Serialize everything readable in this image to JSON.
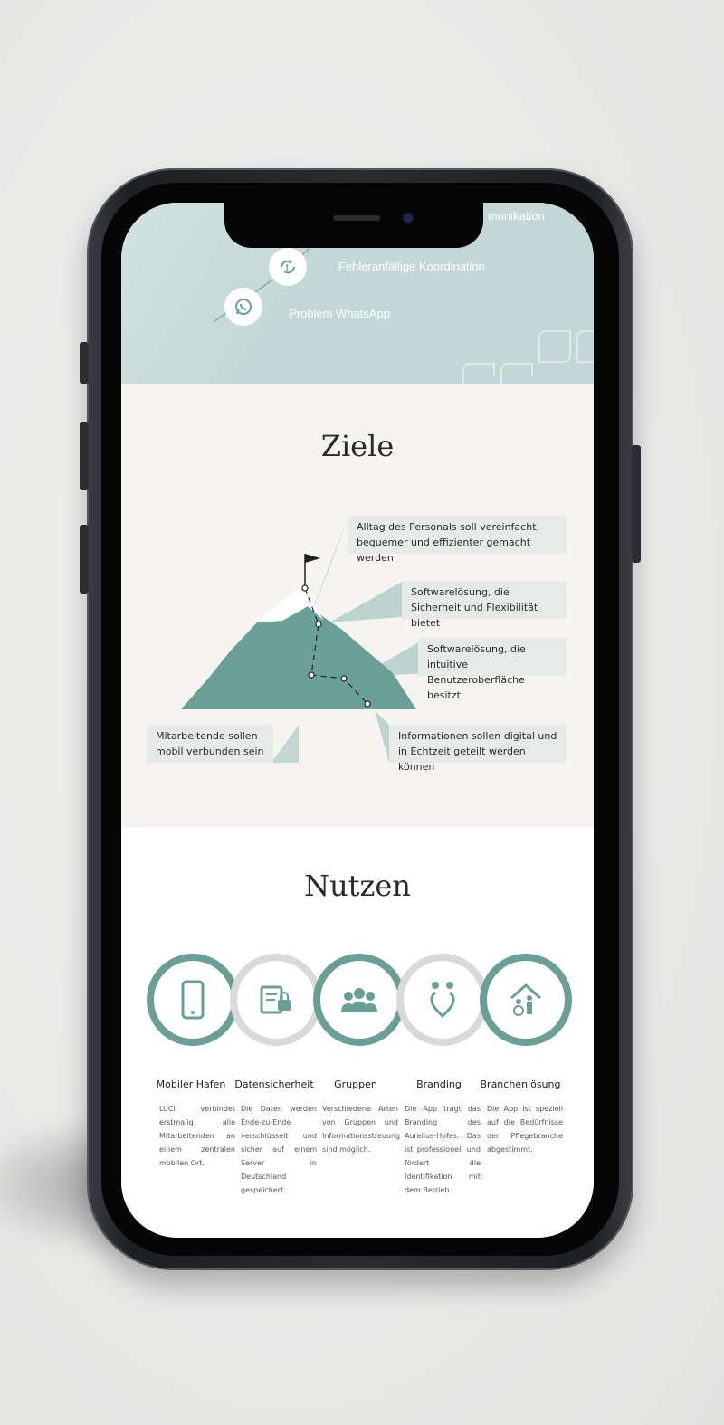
{
  "hero": {
    "items": [
      {
        "label": "munikation",
        "icon": "chat-icon"
      },
      {
        "label": "Fehleranfällige Koordination",
        "icon": "sync-alert-icon"
      },
      {
        "label": "Problem WhatsApp",
        "icon": "whatsapp-icon"
      }
    ]
  },
  "ziele": {
    "title": "Ziele",
    "goals": [
      "Alltag des Personals soll vereinfacht, bequemer und effizienter gemacht werden",
      "Softwarelösung, die Sicherheit und Flexibilität bietet",
      "Softwarelösung, die intuitive Benutzeroberfläche besitzt",
      "Mitarbeitende sollen mobil verbunden sein",
      "Informationen sollen digital und in Echtzeit geteilt werden können"
    ]
  },
  "nutzen": {
    "title": "Nutzen",
    "benefits": [
      {
        "title": "Mobiler Hafen",
        "icon": "smartphone-icon",
        "desc": "LUCI verbindet erstmalig alle Mitarbeitenden an einem zentralen mobilen Ort."
      },
      {
        "title": "Datensicherheit",
        "icon": "secure-document-icon",
        "desc": "Die Daten werden Ende-zu-Ende verschlüsselt und sicher auf einem Server in Deutschland gespeichert."
      },
      {
        "title": "Gruppen",
        "icon": "group-icon",
        "desc": "Verschiedene Arten von Gruppen und Informationsstreuung sind möglich."
      },
      {
        "title": "Branding",
        "icon": "heart-people-icon",
        "desc": "Die App trägt das Branding des Aurelius-Hofes. Das ist professionell und fördert die Identifikation mit dem Betrieb."
      },
      {
        "title": "Branchenlösung",
        "icon": "care-home-icon",
        "desc": "Die App ist speziell auf die Bedürfnisse der Pflegebranche abgestimmt."
      }
    ]
  },
  "colors": {
    "teal": "#6a9f98",
    "hero_bg": "#c3d8d6",
    "ring_grey": "#d9d9d9"
  }
}
